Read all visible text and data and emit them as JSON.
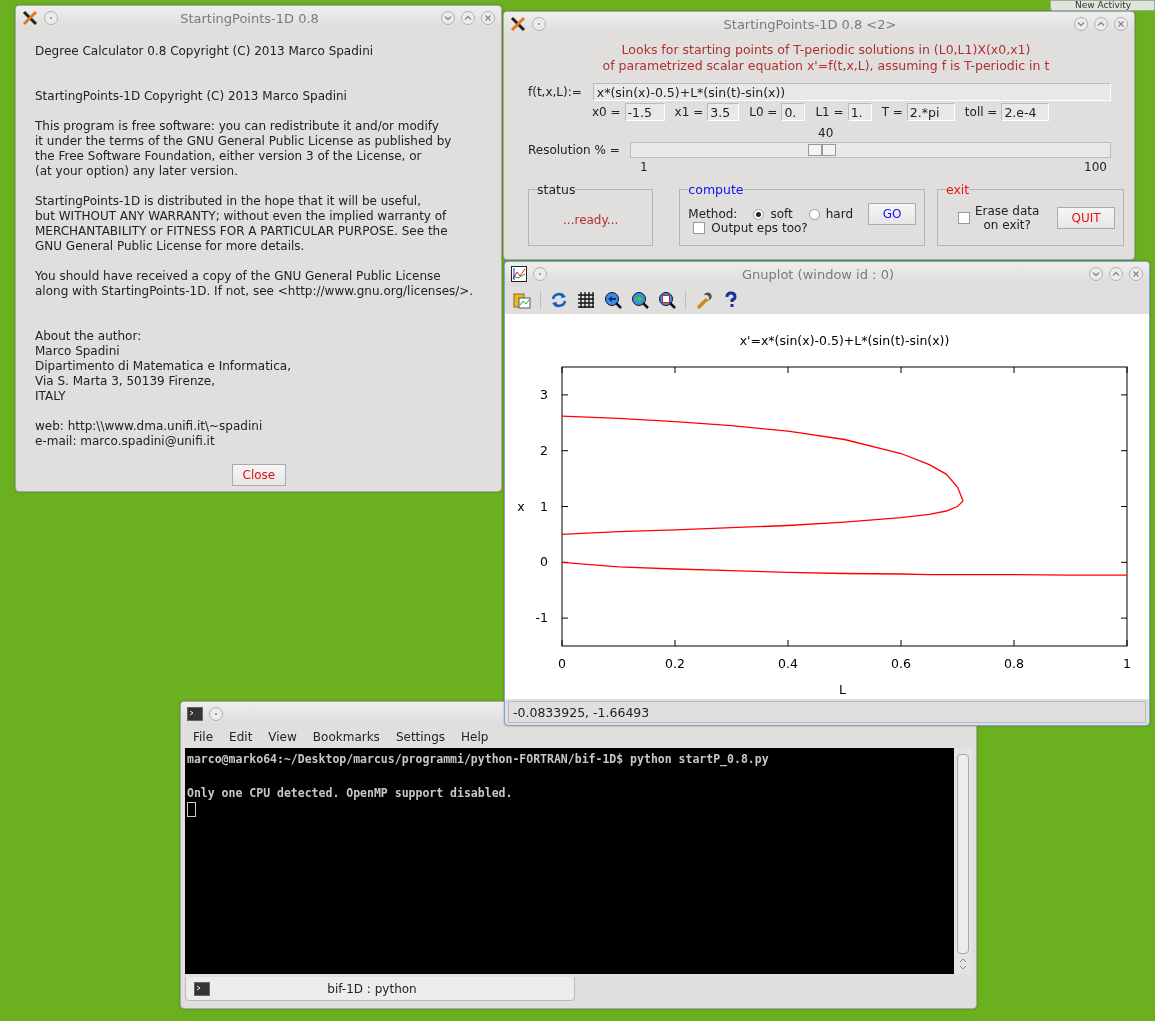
{
  "desktop": {
    "corner_tab": "New Activity"
  },
  "about_window": {
    "title": "StartingPoints-1D 0.8",
    "paragraphs": [
      "Degree Calculator 0.8  Copyright (C) 2013  Marco Spadini",
      "StartingPoints-1D Copyright (C) 2013  Marco Spadini",
      "This program is free software: you can redistribute it and/or modify\nit under the terms of the GNU General Public License as published by\nthe Free Software Foundation, either version 3 of the License, or\n(at your option) any later version.",
      "StartingPoints-1D is distributed in the hope that it will be useful,\nbut WITHOUT ANY WARRANTY; without even the implied warranty of\nMERCHANTABILITY or FITNESS FOR A PARTICULAR PURPOSE.  See the\nGNU General Public License for more details.",
      "You should have received a copy of the GNU General Public License\nalong with StartingPoints-1D.  If not, see <http://www.gnu.org/licenses/>.",
      "About the author:\nMarco Spadini\nDipartimento di Matematica e Informatica,\nVia S. Marta 3, 50139 Firenze,\nITALY",
      "web: http:\\\\www.dma.unifi.it\\~spadini\ne-mail: marco.spadini@unifi.it"
    ],
    "close_button": "Close"
  },
  "main_window": {
    "title": "StartingPoints-1D 0.8 <2>",
    "description": "Looks for starting points of T-periodic solutions in (L0,L1)X(x0,x1)\nof parametrized scalar equation x'=f(t,x,L), assuming f is T-periodic in t",
    "function": {
      "label": "f(t,x,L):=",
      "value": "x*(sin(x)-0.5)+L*(sin(t)-sin(x))"
    },
    "params": [
      {
        "label": "x0 =",
        "value": "-1.5"
      },
      {
        "label": "x1 =",
        "value": "3.5"
      },
      {
        "label": "L0 =",
        "value": "0."
      },
      {
        "label": "L1 =",
        "value": "1."
      },
      {
        "label": "T =",
        "value": "2.*pi"
      },
      {
        "label": "toll =",
        "value": "2.e-4"
      }
    ],
    "resolution": {
      "label": "Resolution % =",
      "reading": "40",
      "level": 0.394,
      "min": "1",
      "max": "100"
    },
    "status": {
      "legend": "status",
      "text": "...ready..."
    },
    "compute": {
      "legend": "compute",
      "method_label": "Method:",
      "methods": [
        {
          "label": "soft",
          "selected": true
        },
        {
          "label": "hard",
          "selected": false
        }
      ],
      "output_eps": {
        "label": "Output eps too?",
        "checked": false
      },
      "go_button": "GO"
    },
    "exit": {
      "legend": "exit",
      "erase": {
        "label": "Erase data\non exit?",
        "checked": false
      },
      "quit_button": "QUIT"
    }
  },
  "gnuplot_window": {
    "title": "Gnuplot (window id : 0)",
    "chart_data": {
      "type": "line",
      "title": "x'=x*(sin(x)-0.5)+L*(sin(t)-sin(x))",
      "xlabel": "L",
      "ylabel": "x",
      "x": [
        0,
        0.1,
        0.2,
        0.3,
        0.4,
        0.5,
        0.6,
        0.65,
        0.68,
        0.7,
        0.71,
        0.8,
        0.9,
        1
      ],
      "series": [
        {
          "color": "#ff0000",
          "values": [
            2.62,
            2.58,
            2.52,
            2.45,
            2.35,
            2.2,
            1.95,
            1.75,
            1.58,
            1.35,
            1.1,
            null,
            null,
            null
          ]
        },
        {
          "color": "#ff0000",
          "values": [
            0.5,
            0.55,
            0.58,
            0.62,
            0.66,
            0.72,
            0.8,
            0.86,
            0.92,
            1.0,
            1.1,
            null,
            null,
            null
          ]
        },
        {
          "color": "#ff0000",
          "values": [
            0,
            -0.08,
            -0.12,
            -0.15,
            -0.18,
            -0.2,
            -0.21,
            -0.22,
            -0.22,
            -0.22,
            -0.22,
            -0.22,
            -0.23,
            -0.23
          ]
        }
      ],
      "xlim": [
        0,
        1
      ],
      "ylim": [
        -1.5,
        3.5
      ],
      "xticks": [
        0,
        0.2,
        0.4,
        0.6,
        0.8,
        1
      ],
      "yticks": [
        -1,
        0,
        1,
        2,
        3
      ]
    },
    "status_text": "-0.0833925, -1.66493"
  },
  "terminal_window": {
    "menu": [
      "File",
      "Edit",
      "View",
      "Bookmarks",
      "Settings",
      "Help"
    ],
    "prompt_line": "marco@marko64:~/Desktop/marcus/programmi/python-FORTRAN/bif-1D$ python startP_0.8.py",
    "output_line": "Only one CPU detected. OpenMP support disabled.",
    "tab": "bif-1D : python"
  }
}
